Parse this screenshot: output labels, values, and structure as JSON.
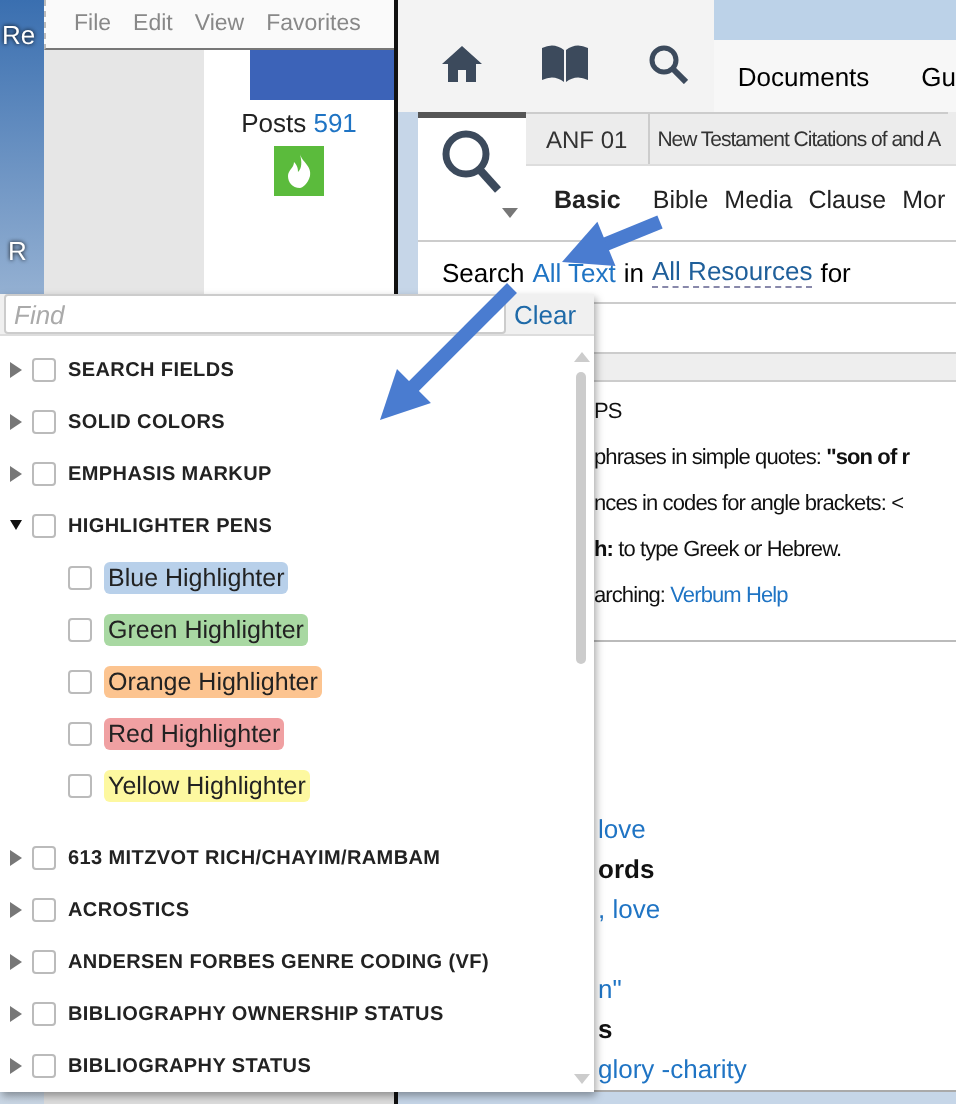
{
  "desktop": {
    "labels": [
      "Re",
      "R"
    ]
  },
  "browser": {
    "menu": [
      "File",
      "Edit",
      "View",
      "Favorites"
    ],
    "posts_label": "Posts",
    "posts_count": "591"
  },
  "app": {
    "nav": [
      "Documents",
      "Gu"
    ],
    "tabs": [
      {
        "kind": "search",
        "selected": true
      },
      {
        "kind": "text",
        "label": "ANF 01",
        "selected": false
      },
      {
        "kind": "text",
        "label": "New Testament Citations of and A",
        "selected": false
      }
    ],
    "modes": [
      {
        "label": "Basic",
        "selected": true
      },
      {
        "label": "Bible",
        "selected": false
      },
      {
        "label": "Media",
        "selected": false
      },
      {
        "label": "Clause",
        "selected": false
      },
      {
        "label": "Mor",
        "selected": false
      }
    ],
    "search_line": {
      "prefix": "Search",
      "scope": "All Text",
      "joiner": "in",
      "resources": "All Resources",
      "suffix": "for"
    },
    "tips": [
      {
        "text": "PS"
      },
      {
        "text": "phrases in simple quotes: **\"son of r**"
      },
      {
        "text": "nces in codes for angle brackets: <"
      },
      {
        "text": "**h:** to type Greek or Hebrew."
      },
      {
        "text": "arching:",
        "link": "Verbum Help"
      }
    ],
    "examples": [
      {
        "items": [
          {
            "kind": "link",
            "text": "love"
          },
          {
            "kind": "heading",
            "text": "ords"
          },
          {
            "kind": "link",
            "text": ", love"
          }
        ]
      },
      {
        "items": [
          {
            "kind": "link",
            "text": "n\""
          },
          {
            "kind": "heading",
            "text": "s"
          },
          {
            "kind": "link",
            "text": "glory -charity"
          }
        ]
      }
    ]
  },
  "dropdown": {
    "find_placeholder": "Find",
    "clear": "Clear",
    "items": [
      {
        "label": "SEARCH FIELDS",
        "expanded": false,
        "checked": false
      },
      {
        "label": "SOLID COLORS",
        "expanded": false,
        "checked": false
      },
      {
        "label": "EMPHASIS MARKUP",
        "expanded": false,
        "checked": false
      },
      {
        "label": "HIGHLIGHTER PENS",
        "expanded": true,
        "checked": false,
        "children": [
          {
            "label": "Blue Highlighter",
            "checked": false,
            "color": "#b8d0ea"
          },
          {
            "label": "Green Highlighter",
            "checked": false,
            "color": "#a8d8a2"
          },
          {
            "label": "Orange Highlighter",
            "checked": false,
            "color": "#fcc490"
          },
          {
            "label": "Red Highlighter",
            "checked": false,
            "color": "#f0a0a2"
          },
          {
            "label": "Yellow Highlighter",
            "checked": false,
            "color": "#fdf8a0"
          }
        ]
      },
      {
        "label": "613 MITZVOT RICH/CHAYIM/RAMBAM",
        "expanded": false,
        "checked": false
      },
      {
        "label": "ACROSTICS",
        "expanded": false,
        "checked": false
      },
      {
        "label": "ANDERSEN FORBES GENRE CODING (VF)",
        "expanded": false,
        "checked": false
      },
      {
        "label": "BIBLIOGRAPHY OWNERSHIP STATUS",
        "expanded": false,
        "checked": false
      },
      {
        "label": "BIBLIOGRAPHY STATUS",
        "expanded": false,
        "checked": false
      }
    ]
  }
}
